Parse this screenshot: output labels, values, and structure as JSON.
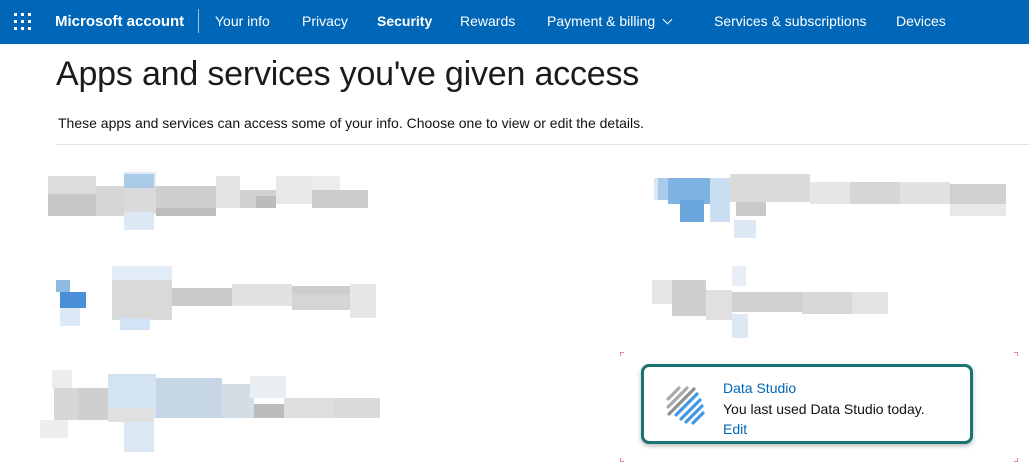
{
  "header": {
    "brand": "Microsoft account",
    "nav": [
      {
        "label": "Your info"
      },
      {
        "label": "Privacy"
      },
      {
        "label": "Security"
      },
      {
        "label": "Rewards"
      },
      {
        "label": "Payment & billing"
      },
      {
        "label": "Services & subscriptions"
      },
      {
        "label": "Devices"
      }
    ],
    "active_item": "Security",
    "accent_color": "#0067b8"
  },
  "main": {
    "title": "Apps and services you've given access",
    "subtitle": "These apps and services can access some of your info. Choose one to view or edit the details."
  },
  "app_card": {
    "name": "Data Studio",
    "status": "You last used Data Studio today.",
    "edit_label": "Edit",
    "icon": "data-studio-icon",
    "highlight_color": "#1a7373"
  }
}
